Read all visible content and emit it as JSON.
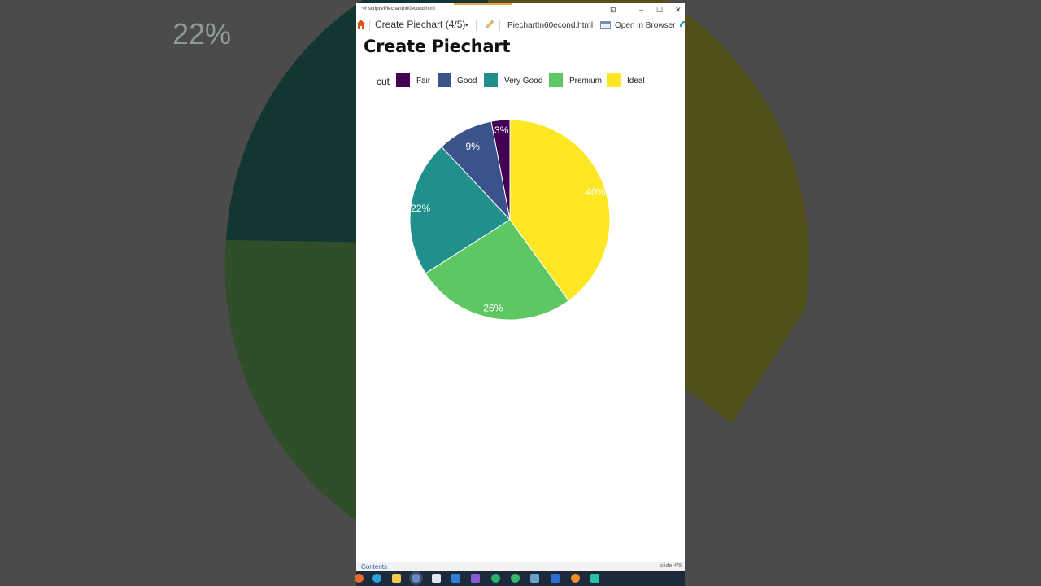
{
  "window": {
    "path": "~/r scripts/PiechartIn60econd.html",
    "controls": [
      "⊡",
      "–",
      "☐",
      "✕"
    ]
  },
  "toolbar": {
    "title": "Create Piechart (4/5)",
    "filename": "PiechartIn60econd.html",
    "open_browser": "Open in Browser"
  },
  "page": {
    "heading": "Create Piechart"
  },
  "background_label": "22%",
  "chart_data": {
    "type": "pie",
    "legend_title": "cut",
    "legend_position": "top",
    "categories": [
      "Fair",
      "Good",
      "Very Good",
      "Premium",
      "Ideal"
    ],
    "values": [
      3,
      9,
      22,
      26,
      40
    ],
    "labels": [
      "3%",
      "9%",
      "22%",
      "26%",
      "40%"
    ],
    "colors": [
      "#440154",
      "#3b528b",
      "#21908c",
      "#5dc863",
      "#fde725"
    ]
  },
  "statusbar": {
    "contents": "Contents",
    "slide": "slide 4/5"
  },
  "colors": {
    "taskbar": "#1d2a3c",
    "background": "#4b4b4b"
  }
}
